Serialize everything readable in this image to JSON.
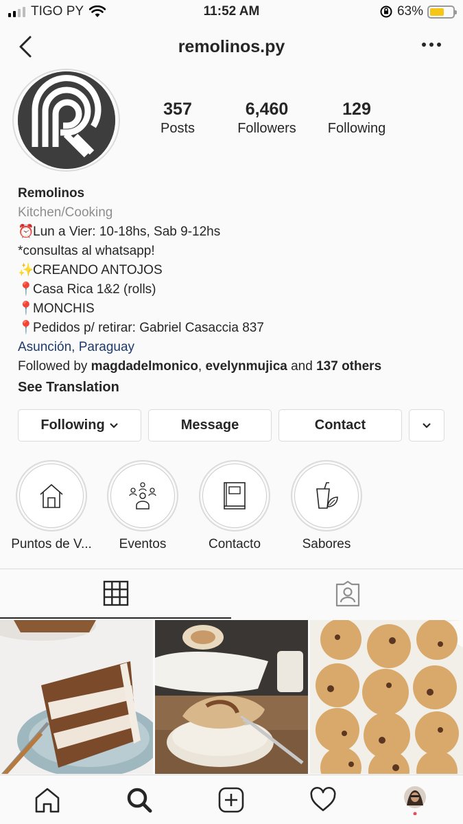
{
  "status": {
    "carrier": "TIGO PY",
    "time": "11:52 AM",
    "battery": "63%",
    "battery_level": 0.63
  },
  "header": {
    "title": "remolinos.py"
  },
  "profile": {
    "stats": [
      {
        "num": "357",
        "label": "Posts"
      },
      {
        "num": "6,460",
        "label": "Followers"
      },
      {
        "num": "129",
        "label": "Following"
      }
    ],
    "name": "Remolinos",
    "category": "Kitchen/Cooking",
    "bio": [
      {
        "emoji": "⏰",
        "text": "Lun a Vier: 10-18hs, Sab 9-12hs"
      },
      {
        "emoji": "",
        "text": "*consultas al whatsapp!"
      },
      {
        "emoji": "✨",
        "text": "CREANDO ANTOJOS"
      },
      {
        "emoji": "📍",
        "text": "Casa Rica 1&2 (rolls)"
      },
      {
        "emoji": "📍",
        "text": "MONCHIS"
      },
      {
        "emoji": "📍",
        "text": "Pedidos p/ retirar: Gabriel Casaccia 837"
      }
    ],
    "location": "Asunción, Paraguay",
    "followed_by": {
      "prefix": "Followed by ",
      "user1": "magdadelmonico",
      "sep": ", ",
      "user2": "evelynmujica",
      "and": " and ",
      "others": "137 others"
    },
    "see_translation": "See Translation"
  },
  "buttons": {
    "following": "Following",
    "message": "Message",
    "contact": "Contact"
  },
  "highlights": [
    {
      "label": "Puntos de V...",
      "icon": "house-icon"
    },
    {
      "label": "Eventos",
      "icon": "people-icon"
    },
    {
      "label": "Contacto",
      "icon": "book-icon"
    },
    {
      "label": "Sabores",
      "icon": "drink-leaf-icon"
    }
  ],
  "tabs": [
    {
      "icon": "grid-icon",
      "active": true
    },
    {
      "icon": "tagged-icon",
      "active": false
    }
  ],
  "posts": [
    {
      "description": "carrot-cake-post"
    },
    {
      "description": "cinnamon-roll-post"
    },
    {
      "description": "cookies-post"
    }
  ],
  "nav": [
    "home-icon",
    "search-icon",
    "add-icon",
    "heart-icon",
    "profile-avatar"
  ],
  "colors": {
    "link": "#1d3a6a",
    "secondary": "#8e8e8e",
    "battery": "#f5c518",
    "notification": "#ed4956"
  }
}
